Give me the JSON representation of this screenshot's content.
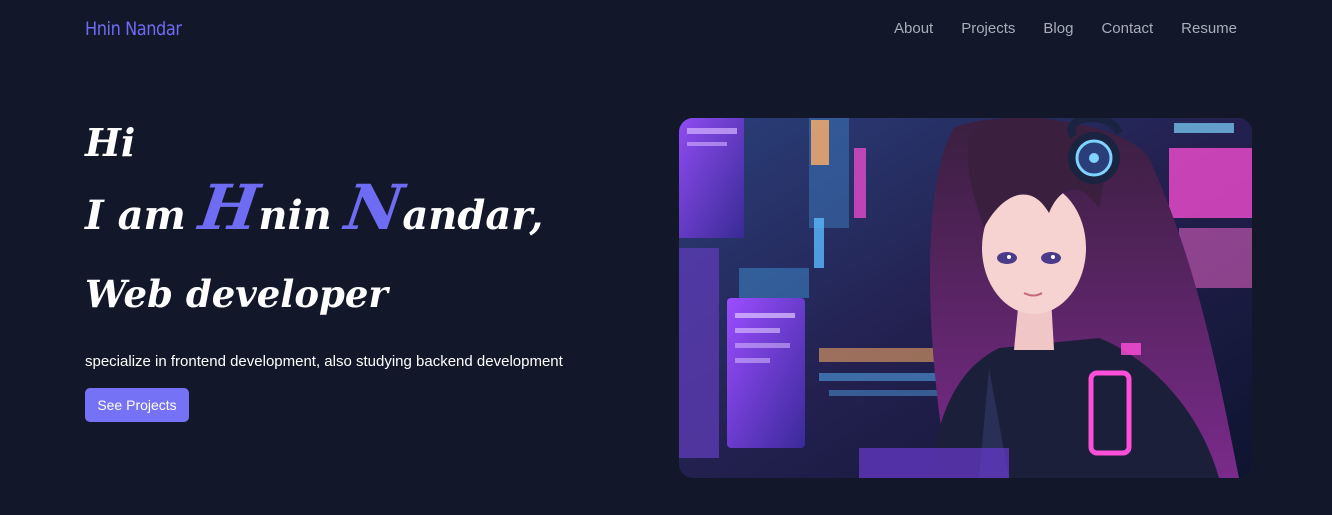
{
  "header": {
    "brand": "Hnin Nandar",
    "nav": [
      {
        "label": "About"
      },
      {
        "label": "Projects"
      },
      {
        "label": "Blog"
      },
      {
        "label": "Contact"
      },
      {
        "label": "Resume"
      }
    ]
  },
  "hero": {
    "greeting": "Hi",
    "intro_prefix": "I am ",
    "first_initial": "H",
    "first_rest": "nin ",
    "last_initial": "N",
    "last_rest": "andar,",
    "role": "Web developer",
    "tagline": "specialize in frontend development, also studying backend development",
    "cta_label": "See Projects",
    "image": {
      "subject": "anime-girl-with-headphones-cyberpunk-city",
      "accent_colors": [
        "#ff4fd8",
        "#5ab8ff",
        "#a64dff"
      ]
    }
  },
  "colors": {
    "background": "#121829",
    "accent": "#6d6cf2",
    "button": "#7672f6",
    "nav_text": "#a8adba"
  }
}
